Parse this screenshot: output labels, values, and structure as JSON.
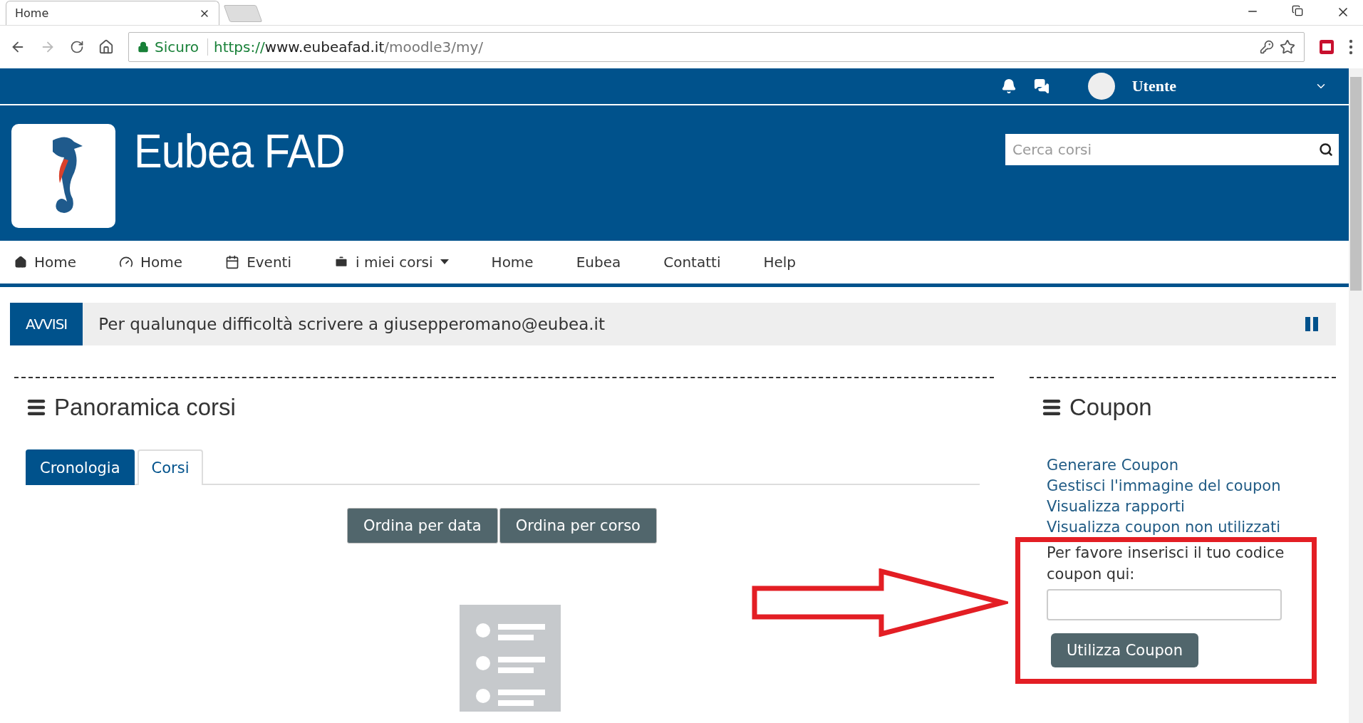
{
  "browser": {
    "tab_title": "Home",
    "secure_label": "Sicuro",
    "url_scheme": "https://",
    "url_host": "www.eubeafad.it",
    "url_path": "/moodle3/my/"
  },
  "top_bar": {
    "user": "Utente"
  },
  "header": {
    "site_name": "Eubea FAD",
    "search": {
      "placeholder": "Cerca corsi"
    }
  },
  "nav": [
    {
      "label": "Home",
      "kind": "home"
    },
    {
      "label": "Home",
      "kind": "dashboard"
    },
    {
      "label": "Eventi",
      "kind": "calendar"
    },
    {
      "label": "i miei corsi",
      "kind": "courses",
      "dropdown": true
    },
    {
      "label": "Home",
      "kind": "plain",
      "dropdown": false
    },
    {
      "label": "Eubea",
      "kind": "plain",
      "dropdown": false
    },
    {
      "label": "Contatti",
      "kind": "plain",
      "dropdown": false
    },
    {
      "label": "Help",
      "kind": "plain",
      "dropdown": false
    }
  ],
  "notice": {
    "label": "AVVISI",
    "text": "Per qualunque difficoltà scrivere a giusepperomano@eubea.it"
  },
  "course_overview": {
    "title": "Panoramica corsi",
    "tabs": [
      {
        "label": "Cronologia",
        "selected": true
      },
      {
        "label": "Corsi",
        "selected": false
      }
    ],
    "sort_buttons": [
      "Ordina per data",
      "Ordina per corso"
    ]
  },
  "coupon": {
    "title": "Coupon",
    "links": [
      "Generare Coupon",
      "Gestisci l'immagine del coupon",
      "Visualizza rapporti",
      "Visualizza coupon non utilizzati"
    ],
    "prompt": "Per favore inserisci il tuo codice coupon qui:",
    "button": "Utilizza Coupon"
  }
}
